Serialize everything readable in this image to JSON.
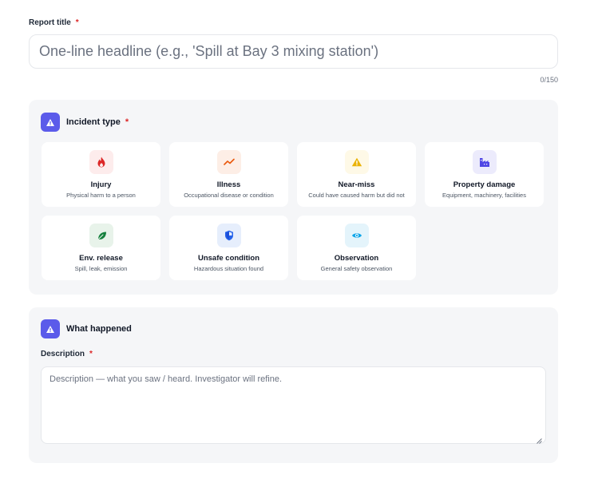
{
  "report_title": {
    "label": "Report title",
    "required_mark": "*",
    "placeholder": "One-line headline (e.g., 'Spill at Bay 3 mixing station')",
    "value": "",
    "counter": "0/150"
  },
  "incident_type": {
    "title": "Incident type",
    "required_mark": "*",
    "icon": "warning-triangle-icon",
    "accent_color": "#5b5bea",
    "options": [
      {
        "label": "Injury",
        "sub": "Physical harm to a person",
        "icon": "flame-icon",
        "color": "#dc2626",
        "bg": "#fdecec"
      },
      {
        "label": "Illness",
        "sub": "Occupational disease or condition",
        "icon": "trend-line-icon",
        "color": "#ea580c",
        "bg": "#fdeee6"
      },
      {
        "label": "Near-miss",
        "sub": "Could have caused harm but did not",
        "icon": "warning-triangle-icon",
        "color": "#eab308",
        "bg": "#fef9e7"
      },
      {
        "label": "Property damage",
        "sub": "Equipment, machinery, facilities",
        "icon": "factory-icon",
        "color": "#4f46e5",
        "bg": "#ecebfc"
      },
      {
        "label": "Env. release",
        "sub": "Spill, leak, emission",
        "icon": "leaf-icon",
        "color": "#15803d",
        "bg": "#e8f3ea"
      },
      {
        "label": "Unsafe condition",
        "sub": "Hazardous situation found",
        "icon": "shield-icon",
        "color": "#2563eb",
        "bg": "#e6eefc"
      },
      {
        "label": "Observation",
        "sub": "General safety observation",
        "icon": "eye-icon",
        "color": "#0ea5e9",
        "bg": "#e4f4fb"
      }
    ]
  },
  "what_happened": {
    "title": "What happened",
    "icon": "warning-triangle-icon",
    "description": {
      "label": "Description",
      "required_mark": "*",
      "placeholder": "Description — what you saw / heard. Investigator will refine.",
      "value": ""
    }
  }
}
